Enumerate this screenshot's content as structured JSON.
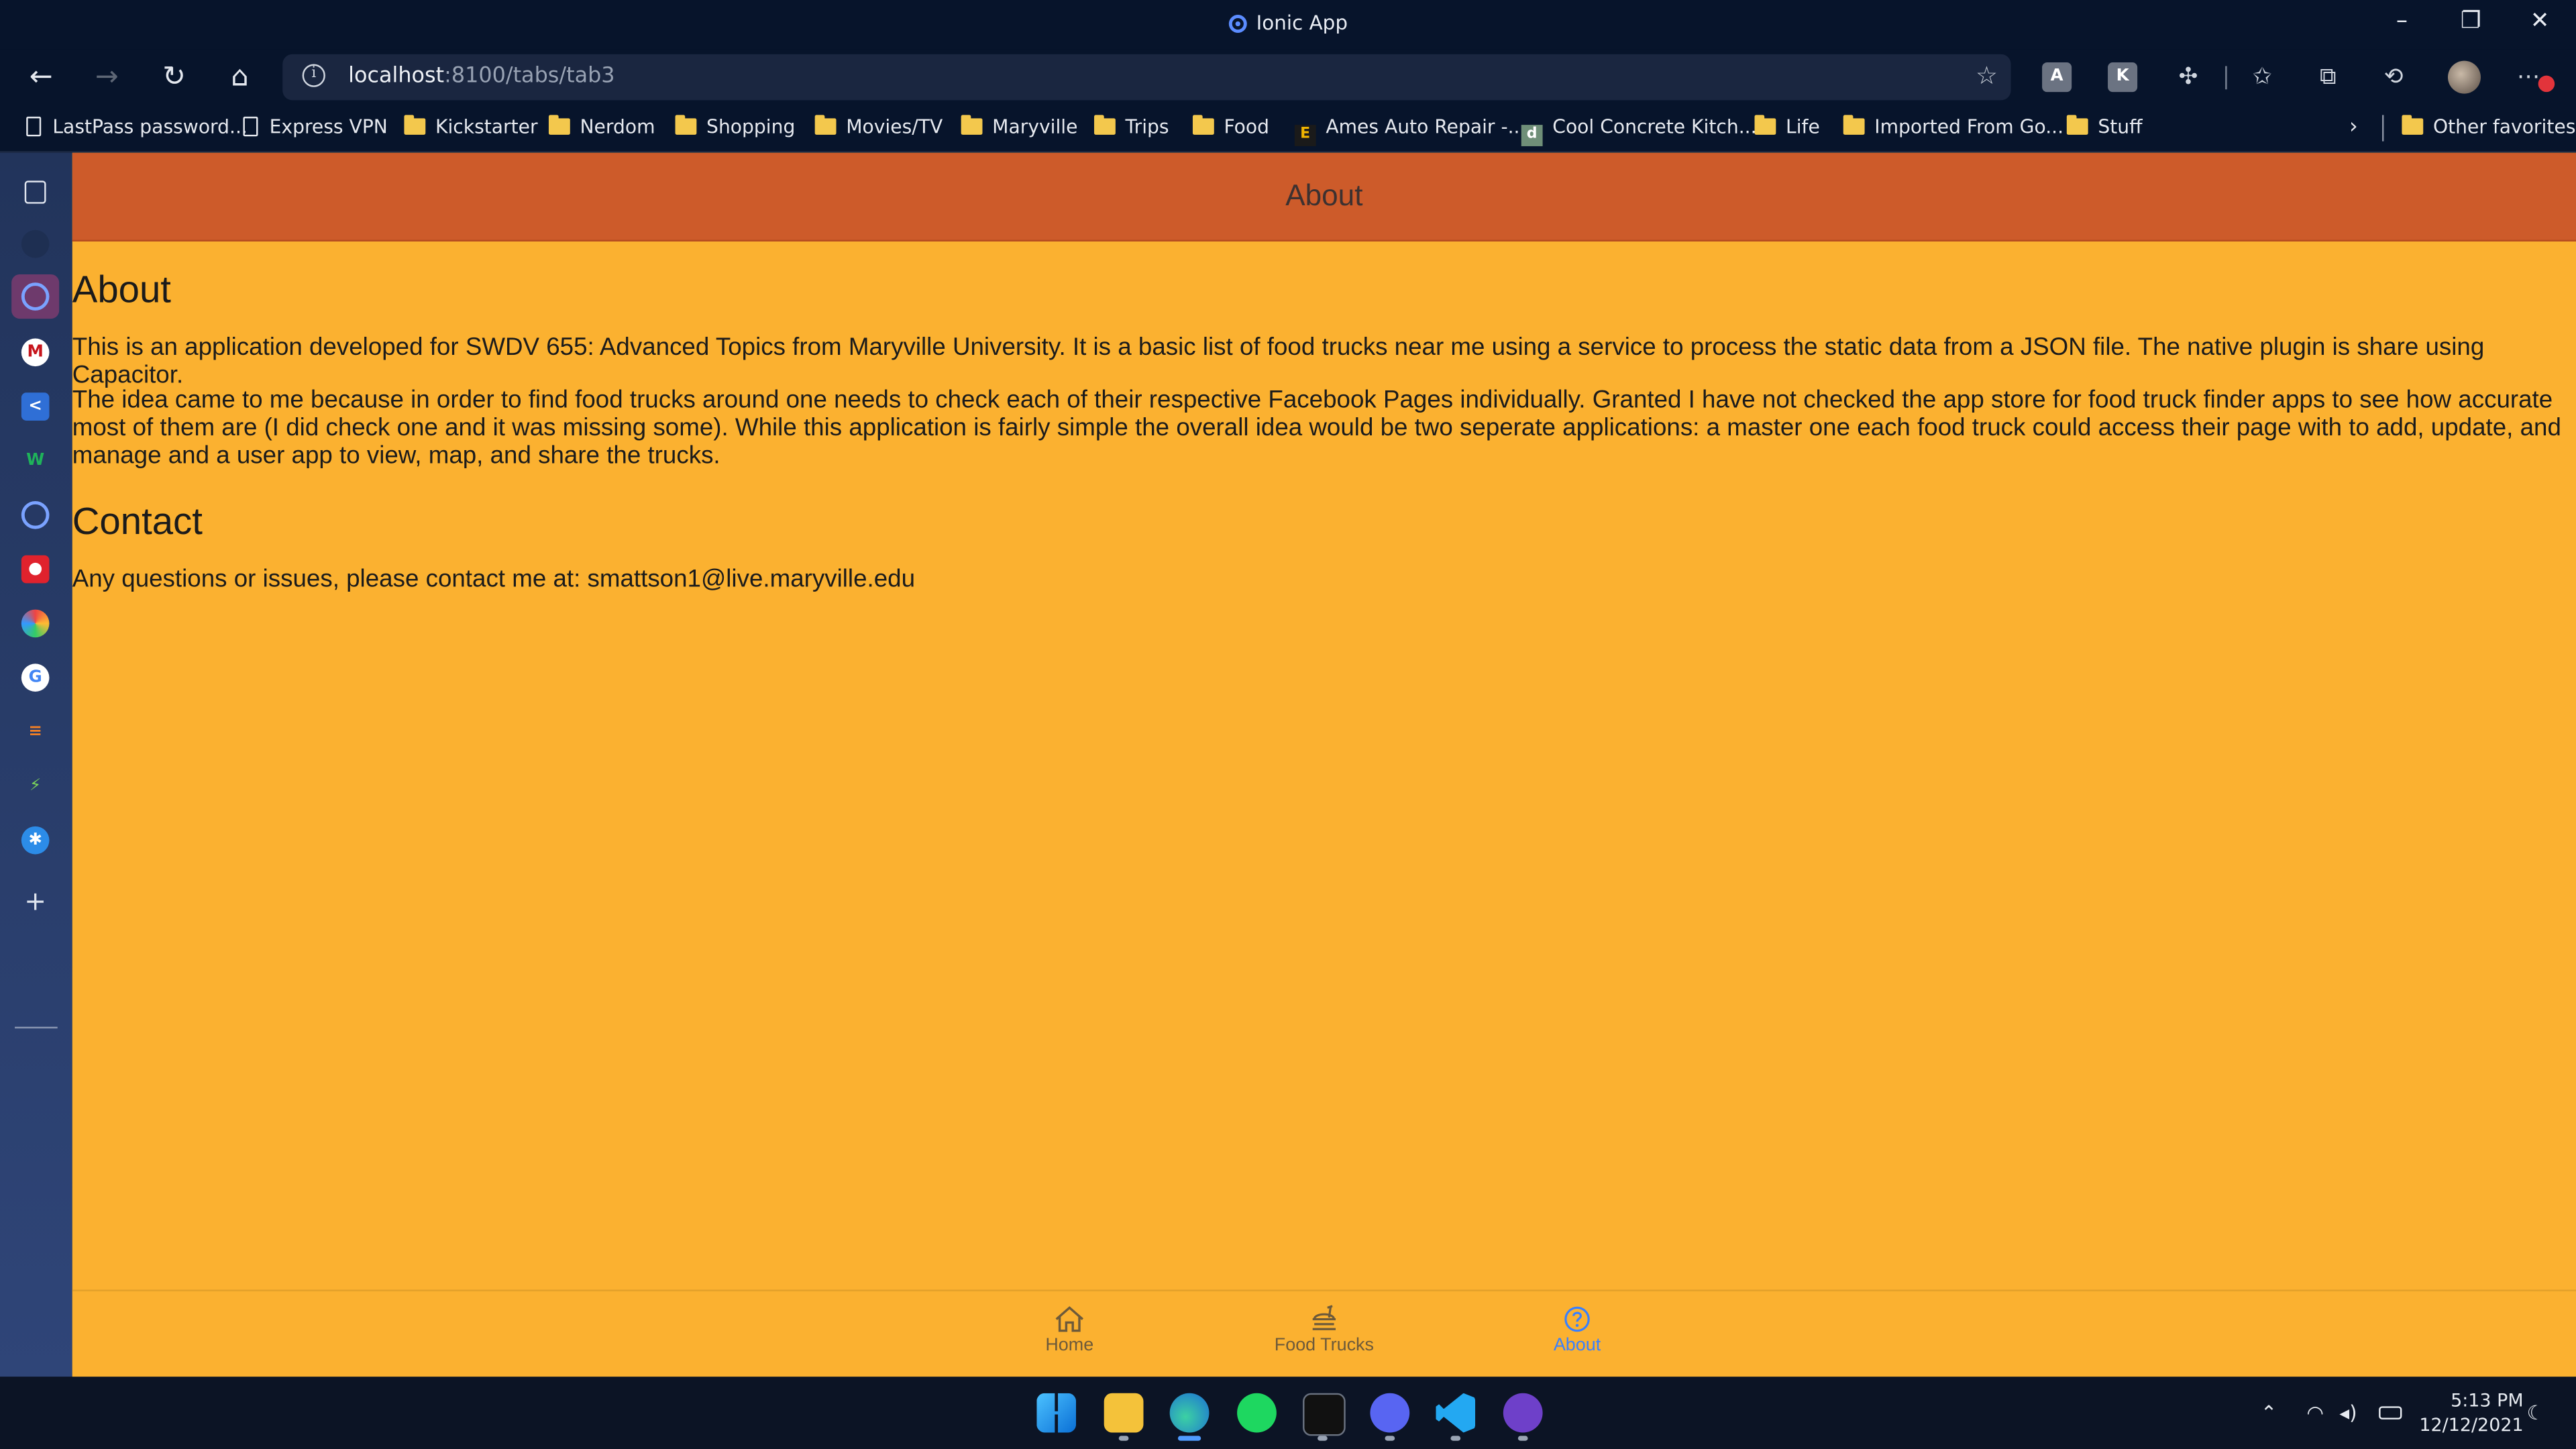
{
  "window": {
    "title": "Ionic App"
  },
  "browser": {
    "url_host": "localhost",
    "url_rest": ":8100/tabs/tab3"
  },
  "favorites": [
    {
      "label": "LastPass password...",
      "kind": "doc"
    },
    {
      "label": "Express VPN",
      "kind": "doc"
    },
    {
      "label": "Kickstarter",
      "kind": "folder"
    },
    {
      "label": "Nerdom",
      "kind": "folder"
    },
    {
      "label": "Shopping",
      "kind": "folder"
    },
    {
      "label": "Movies/TV",
      "kind": "folder"
    },
    {
      "label": "Maryville",
      "kind": "folder"
    },
    {
      "label": "Trips",
      "kind": "folder"
    },
    {
      "label": "Food",
      "kind": "folder"
    },
    {
      "label": "Ames Auto Repair -...",
      "kind": "site"
    },
    {
      "label": "Cool Concrete Kitch...",
      "kind": "site"
    },
    {
      "label": "Life",
      "kind": "folder"
    },
    {
      "label": "Imported From Go...",
      "kind": "folder"
    },
    {
      "label": "Stuff",
      "kind": "folder"
    }
  ],
  "other_favorites": "Other favorites",
  "app": {
    "toolbar_title": "About",
    "about_heading": "About",
    "about_p1": "This is an application developed for SWDV 655: Advanced Topics from Maryville University. It is a basic list of food trucks near me using a service to process the static data from a JSON file. The native plugin is share using Capacitor.",
    "about_p2": "The idea came to me because in order to find food trucks around one needs to check each of their respective Facebook Pages individually. Granted I have not checked the app store for food truck finder apps to see how accurate most of them are (I did check one and it was missing some). While this application is fairly simple the overall idea would be two seperate applications: a master one each food truck could access their page with to add, update, and manage and a user app to view, map, and share the trucks.",
    "contact_heading": "Contact",
    "contact_p": "Any questions or issues, please contact me at: smattson1@live.maryville.edu",
    "tabs": [
      {
        "label": "Home",
        "icon": "home-icon",
        "selected": false
      },
      {
        "label": "Food Trucks",
        "icon": "fast-food-icon",
        "selected": false
      },
      {
        "label": "About",
        "icon": "help-circle-icon",
        "selected": true
      }
    ]
  },
  "colors": {
    "toolbar": "#cd5b2a",
    "page_bg": "#fbb130",
    "tab_selected": "#3880ff"
  },
  "clock": {
    "time": "5:13 PM",
    "date": "12/12/2021"
  }
}
